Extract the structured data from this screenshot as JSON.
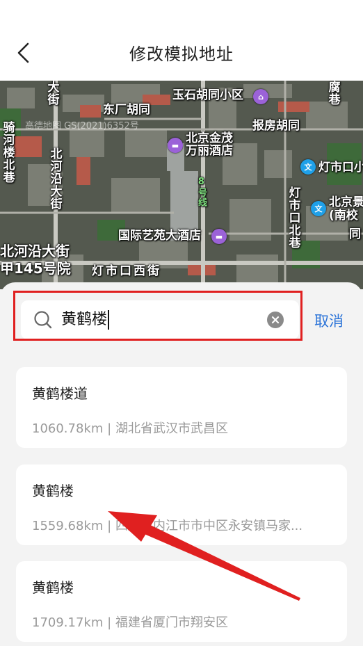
{
  "header": {
    "title": "修改模拟地址",
    "back_icon": "chevron-left-icon"
  },
  "map": {
    "watermark": "高德地图 GS(2021)6352号",
    "labels": {
      "yushi": "玉石胡同小区",
      "donghuangchang": "东厂胡同",
      "baofang": "报房胡同",
      "jinmao_1": "北京金茂",
      "jinmao_2": "万丽酒店",
      "dengshikou_top": "灯市口小",
      "beijing_jing_1": "北京景",
      "beijing_jing_2": "(南校",
      "yiyuan": "国际艺苑大酒店",
      "beiheyan_street": "北河沿大街",
      "jia145": "甲145号院",
      "dengshikou_west": "灯市口西街",
      "beiheyan_vertical": "北河沿大街",
      "qihe_vertical": "骑河楼北巷",
      "dengshikou_vertical": "灯市口北巷",
      "line8": "8号线",
      "tong": "同",
      "fu": "腐巷",
      "da": "大街"
    },
    "poi_icons": [
      "hotel-icon",
      "hotel-icon",
      "school-icon",
      "school-icon",
      "community-icon"
    ]
  },
  "search": {
    "value": "黄鹤楼",
    "icon": "search-icon",
    "clear_icon": "clear-icon",
    "cancel_label": "取消"
  },
  "results": [
    {
      "name": "黄鹤楼道",
      "distance": "1060.78km",
      "separator": "|",
      "address": "湖北省武汉市武昌区"
    },
    {
      "name": "黄鹤楼",
      "distance": "1559.68km",
      "separator": "|",
      "address": "四川省内江市市中区永安镇马家..."
    },
    {
      "name": "黄鹤楼",
      "distance": "1709.17km",
      "separator": "|",
      "address": "福建省厦门市翔安区"
    }
  ],
  "annotation": {
    "highlight_color": "#e02020",
    "arrow_color": "#e02020"
  },
  "colors": {
    "accent": "#2c74d8",
    "poi_purple": "#9b62d8",
    "poi_blue": "#1fa0e8"
  }
}
